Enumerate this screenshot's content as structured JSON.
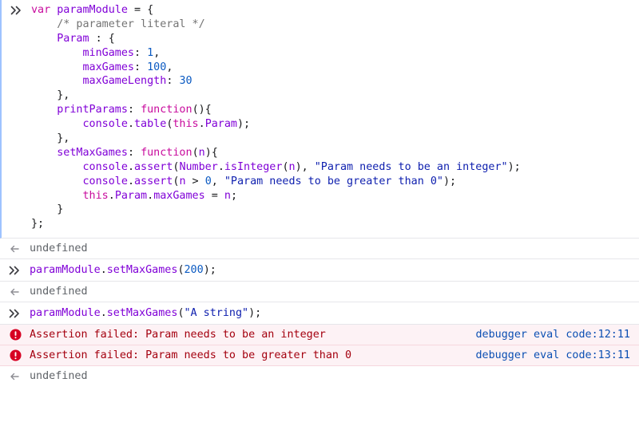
{
  "input1": {
    "lines": [
      [
        [
          "kw",
          "var"
        ],
        [
          "pl",
          " "
        ],
        [
          "id",
          "paramModule"
        ],
        [
          "pl",
          " = {"
        ]
      ],
      [
        [
          "pl",
          "    "
        ],
        [
          "cmt",
          "/* parameter literal */"
        ]
      ],
      [
        [
          "pl",
          "    "
        ],
        [
          "id",
          "Param"
        ],
        [
          "pl",
          " : {"
        ]
      ],
      [
        [
          "pl",
          "        "
        ],
        [
          "id",
          "minGames"
        ],
        [
          "pl",
          ": "
        ],
        [
          "num",
          "1"
        ],
        [
          "pl",
          ","
        ]
      ],
      [
        [
          "pl",
          "        "
        ],
        [
          "id",
          "maxGames"
        ],
        [
          "pl",
          ": "
        ],
        [
          "num",
          "100"
        ],
        [
          "pl",
          ","
        ]
      ],
      [
        [
          "pl",
          "        "
        ],
        [
          "id",
          "maxGameLength"
        ],
        [
          "pl",
          ": "
        ],
        [
          "num",
          "30"
        ]
      ],
      [
        [
          "pl",
          "    },"
        ]
      ],
      [
        [
          "pl",
          "    "
        ],
        [
          "id",
          "printParams"
        ],
        [
          "pl",
          ": "
        ],
        [
          "kw",
          "function"
        ],
        [
          "pl",
          "(){"
        ]
      ],
      [
        [
          "pl",
          "        "
        ],
        [
          "id",
          "console"
        ],
        [
          "pl",
          "."
        ],
        [
          "id",
          "table"
        ],
        [
          "pl",
          "("
        ],
        [
          "kw",
          "this"
        ],
        [
          "pl",
          "."
        ],
        [
          "id",
          "Param"
        ],
        [
          "pl",
          ");"
        ]
      ],
      [
        [
          "pl",
          "    },"
        ]
      ],
      [
        [
          "pl",
          "    "
        ],
        [
          "id",
          "setMaxGames"
        ],
        [
          "pl",
          ": "
        ],
        [
          "kw",
          "function"
        ],
        [
          "pl",
          "("
        ],
        [
          "id",
          "n"
        ],
        [
          "pl",
          "){"
        ]
      ],
      [
        [
          "pl",
          "        "
        ],
        [
          "id",
          "console"
        ],
        [
          "pl",
          "."
        ],
        [
          "id",
          "assert"
        ],
        [
          "pl",
          "("
        ],
        [
          "id",
          "Number"
        ],
        [
          "pl",
          "."
        ],
        [
          "id",
          "isInteger"
        ],
        [
          "pl",
          "("
        ],
        [
          "id",
          "n"
        ],
        [
          "pl",
          "), "
        ],
        [
          "str",
          "\"Param needs to be an integer\""
        ],
        [
          "pl",
          ");"
        ]
      ],
      [
        [
          "pl",
          "        "
        ],
        [
          "id",
          "console"
        ],
        [
          "pl",
          "."
        ],
        [
          "id",
          "assert"
        ],
        [
          "pl",
          "("
        ],
        [
          "id",
          "n"
        ],
        [
          "pl",
          " > "
        ],
        [
          "num",
          "0"
        ],
        [
          "pl",
          ", "
        ],
        [
          "str",
          "\"Param needs to be greater than 0\""
        ],
        [
          "pl",
          ");"
        ]
      ],
      [
        [
          "pl",
          "        "
        ],
        [
          "kw",
          "this"
        ],
        [
          "pl",
          "."
        ],
        [
          "id",
          "Param"
        ],
        [
          "pl",
          "."
        ],
        [
          "id",
          "maxGames"
        ],
        [
          "pl",
          " = "
        ],
        [
          "id",
          "n"
        ],
        [
          "pl",
          ";"
        ]
      ],
      [
        [
          "pl",
          "    }"
        ]
      ],
      [
        [
          "pl",
          "};"
        ]
      ]
    ]
  },
  "result1": "undefined",
  "input2": {
    "lines": [
      [
        [
          "id",
          "paramModule"
        ],
        [
          "pl",
          "."
        ],
        [
          "id",
          "setMaxGames"
        ],
        [
          "pl",
          "("
        ],
        [
          "num",
          "200"
        ],
        [
          "pl",
          ");"
        ]
      ]
    ]
  },
  "result2": "undefined",
  "input3": {
    "lines": [
      [
        [
          "id",
          "paramModule"
        ],
        [
          "pl",
          "."
        ],
        [
          "id",
          "setMaxGames"
        ],
        [
          "pl",
          "("
        ],
        [
          "str",
          "\"A string\""
        ],
        [
          "pl",
          ");"
        ]
      ]
    ]
  },
  "errors": [
    {
      "message": "Assertion failed: Param needs to be an integer",
      "source": "debugger eval code",
      "location": ":12:11"
    },
    {
      "message": "Assertion failed: Param needs to be greater than 0",
      "source": "debugger eval code",
      "location": ":13:11"
    }
  ],
  "result3": "undefined",
  "icons": {
    "prompt": "chevron-double-right-icon",
    "result": "arrow-left-icon",
    "error": "error-circle-icon"
  },
  "colors": {
    "keyword": "#c80b9d",
    "identifier": "#8000d7",
    "number": "#0b5ac2",
    "string": "#0d1eae",
    "comment": "#737373",
    "error_text": "#a4000f",
    "error_bg": "#fdf2f5",
    "link": "#0b4fb3"
  }
}
